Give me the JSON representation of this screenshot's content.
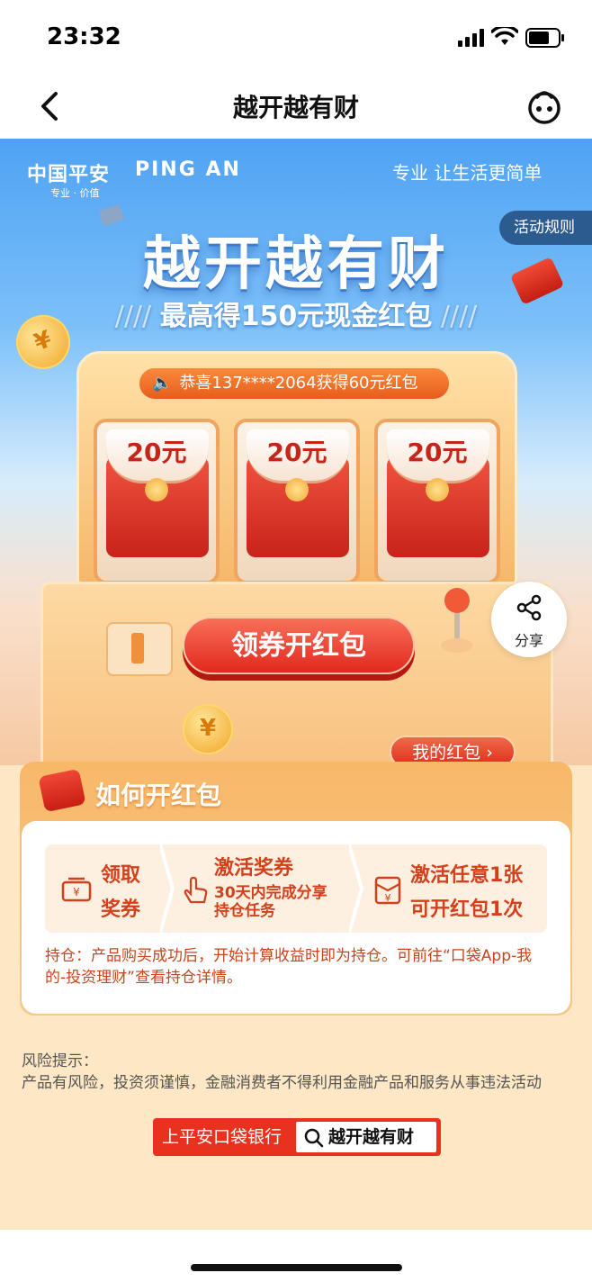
{
  "status": {
    "time": "23:32"
  },
  "nav": {
    "title": "越开越有财"
  },
  "hero": {
    "logo_cn": "中国平安",
    "logo_en": "PING AN",
    "logo_sub": "专业 · 价值",
    "slogan": "专业 让生活更简单",
    "rules": "活动规则",
    "title": "越开越有财",
    "subtitle": "最高得150元现金红包",
    "notice": "恭喜137****2064获得60元红包",
    "reels": [
      "20元",
      "20元",
      "20元"
    ],
    "open_button": "领券开红包",
    "my_packets": "我的红包 ›",
    "share": "分享",
    "coin_symbol": "¥"
  },
  "howto": {
    "title": "如何开红包",
    "steps": [
      {
        "line1": "领取",
        "line2": "奖券"
      },
      {
        "title": "激活奖券",
        "desc1": "30天内完成分享",
        "desc2": "持仓任务"
      },
      {
        "line1": "激活任意1张",
        "line2": "可开红包1次"
      }
    ],
    "note": "持仓：产品购买成功后，开始计算收益时即为持仓。可前往“口袋App-我的-投资理财”查看持仓详情。"
  },
  "risk": {
    "title": "风险提示：",
    "text": "产品有风险，投资须谨慎，金融消费者不得利用金融产品和服务从事违法活动"
  },
  "search_banner": {
    "label": "上平安口袋银行",
    "query": "越开越有财"
  }
}
